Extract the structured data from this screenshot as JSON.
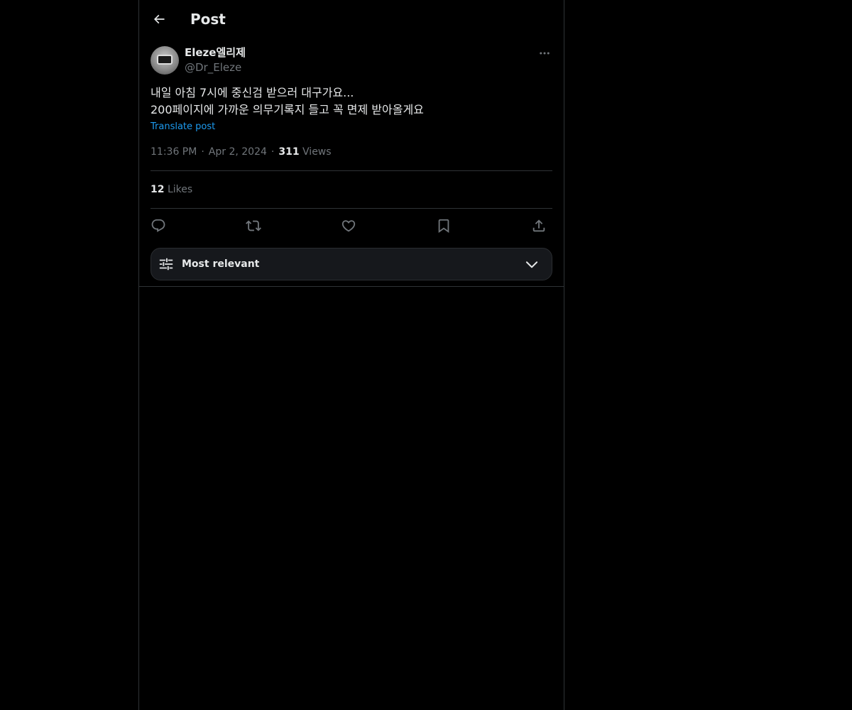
{
  "header": {
    "title": "Post"
  },
  "post": {
    "author": {
      "display_name": "Eleze엘리제",
      "handle": "@Dr_Eleze"
    },
    "text_lines": [
      "내일 아침 7시에 중신검 받으러 대구가요...",
      "200페이지에 가까운 의무기록지 들고 꼭 면제 받아올게요"
    ],
    "translate_label": "Translate post",
    "time": "11:36 PM",
    "date": "Apr 2, 2024",
    "separator": "·",
    "views_count": "311",
    "views_label": "Views",
    "likes_count": "12",
    "likes_label": "Likes"
  },
  "actions": [
    "reply-icon",
    "repost-icon",
    "like-icon",
    "bookmark-icon",
    "share-icon"
  ],
  "sort": {
    "label": "Most relevant"
  },
  "colors": {
    "background": "#000000",
    "text": "#e7e9ea",
    "secondary_text": "#71767b",
    "accent": "#1d9bf0",
    "border": "#2f3336"
  }
}
